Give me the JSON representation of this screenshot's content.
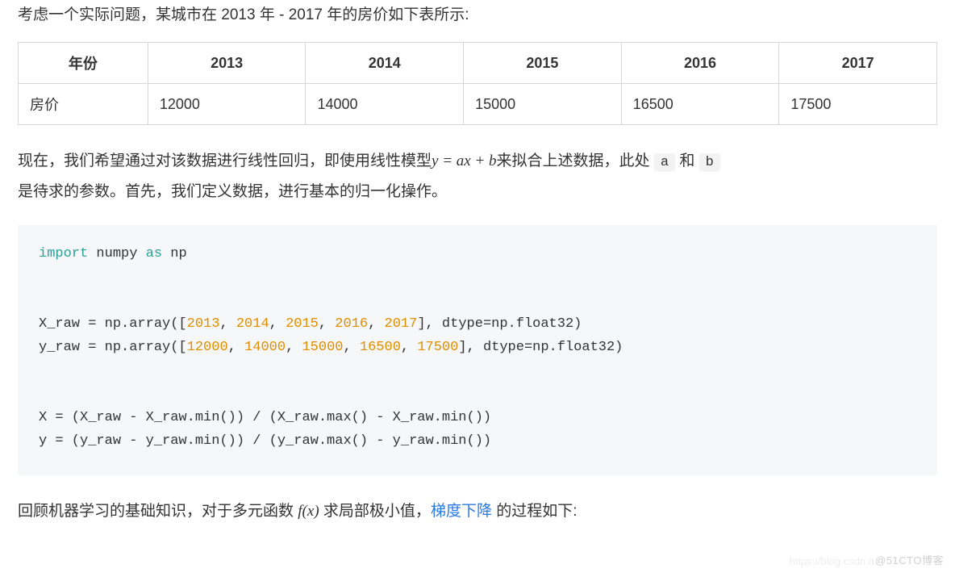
{
  "intro": "考虑一个实际问题，某城市在 2013 年 - 2017 年的房价如下表所示:",
  "table": {
    "header": [
      "年份",
      "2013",
      "2014",
      "2015",
      "2016",
      "2017"
    ],
    "row_label": "房价",
    "row_values": [
      "12000",
      "14000",
      "15000",
      "16500",
      "17500"
    ]
  },
  "para2_a": "现在，我们希望通过对该数据进行线性回归，即使用线性模型",
  "para2_eq": "y = ax + b",
  "para2_b": "来拟合上述数据，此处",
  "code_a": "a",
  "and_word": "和",
  "code_b": "b",
  "para2_c": "是待求的参数。首先，我们定义数据，进行基本的归一化操作。",
  "code": {
    "l1_kw1": "import",
    "l1_mid": " numpy ",
    "l1_kw2": "as",
    "l1_end": " np",
    "l2_a": "X_raw = np.array([",
    "l2_n1": "2013",
    "l2_n2": "2014",
    "l2_n3": "2015",
    "l2_n4": "2016",
    "l2_n5": "2017",
    "l2_b": "], dtype=np.float32)",
    "l3_a": "y_raw = np.array([",
    "l3_n1": "12000",
    "l3_n2": "14000",
    "l3_n3": "15000",
    "l3_n4": "16500",
    "l3_n5": "17500",
    "l3_b": "], dtype=np.float32)",
    "l4": "X = (X_raw - X_raw.min()) / (X_raw.max() - X_raw.min())",
    "l5": "y = (y_raw - y_raw.min()) / (y_raw.max() - y_raw.min())"
  },
  "para3_a": "回顾机器学习的基础知识，对于多元函数 ",
  "para3_fx": "f(x)",
  "para3_b": " 求局部极小值，",
  "para3_link": "梯度下降",
  "para3_c": " 的过程如下:",
  "watermark1": "@51CTO博客",
  "watermark2": "https://blog.csdn.n",
  "chart_data": {
    "type": "table",
    "columns": [
      "年份",
      "2013",
      "2014",
      "2015",
      "2016",
      "2017"
    ],
    "rows": [
      [
        "房价",
        12000,
        14000,
        15000,
        16500,
        17500
      ]
    ]
  }
}
